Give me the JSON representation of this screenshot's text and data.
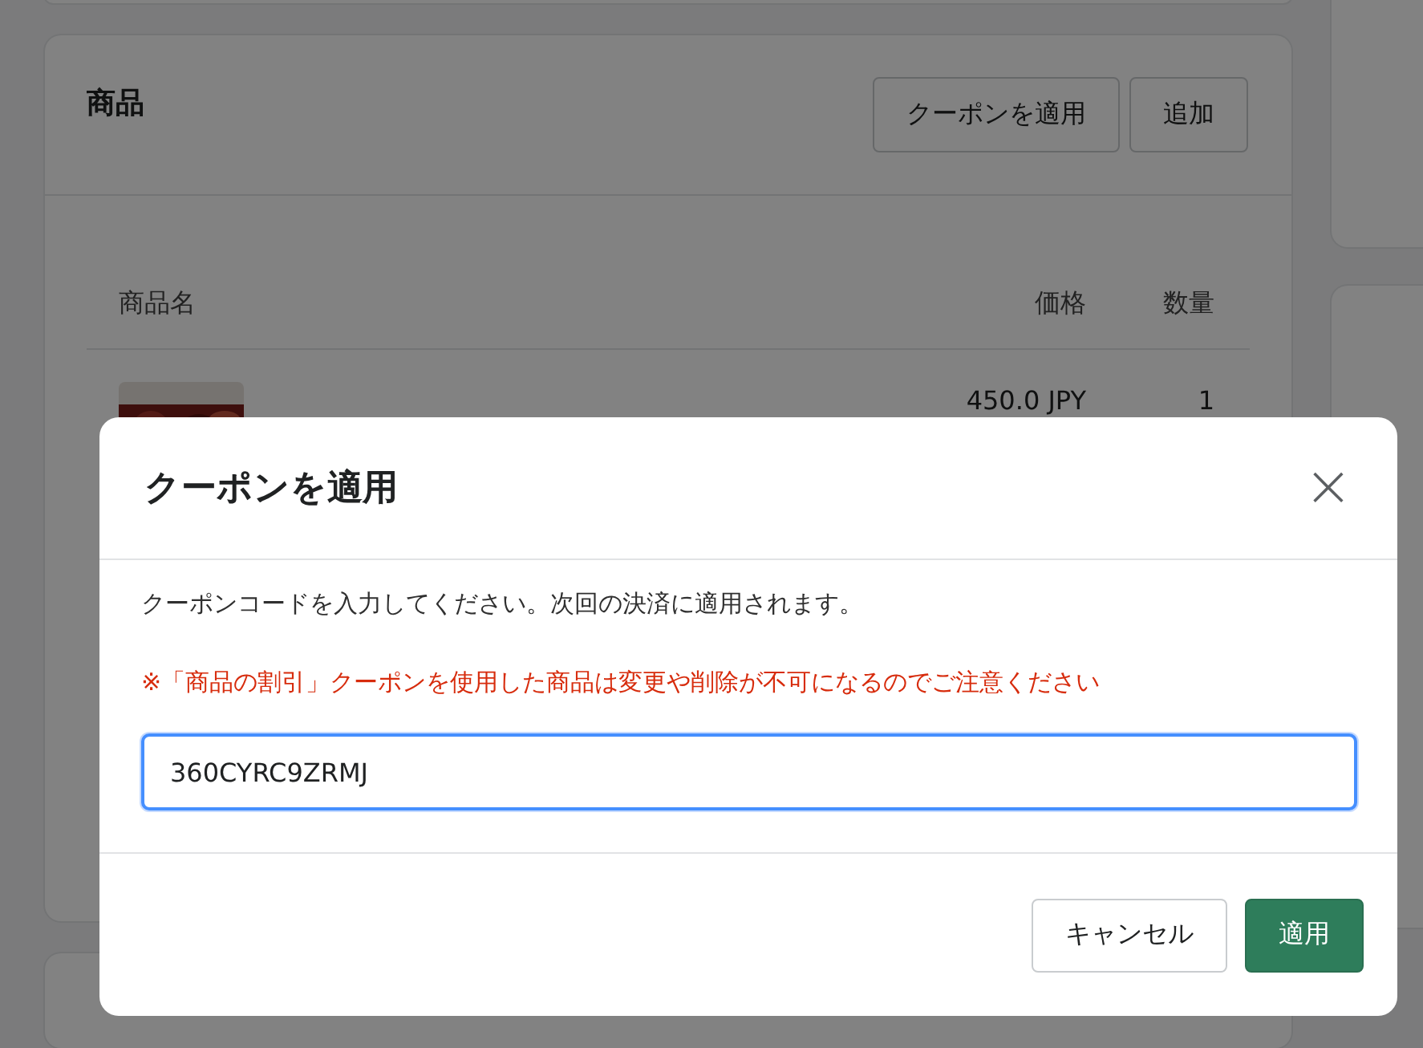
{
  "products_card": {
    "title": "商品",
    "actions": [
      "クーポンを適用",
      "追加"
    ],
    "columns": [
      "商品名",
      "価格",
      "数量"
    ],
    "rows": [
      {
        "price": "450.0 JPY",
        "quantity": "1"
      }
    ]
  },
  "dialog": {
    "title": "クーポンを適用",
    "close": "×",
    "description": "クーポンコードを入力してください。次回の決済に適用されます。",
    "warning": "※「商品の割引」クーポンを使用した商品は変更や削除が不可になるのでご注意ください",
    "coupon_field": {
      "value": "360CYRC9ZRMJ"
    },
    "buttons": [
      {
        "label": "キャンセル",
        "kind": "secondary"
      },
      {
        "label": "適用",
        "kind": "primary"
      }
    ]
  }
}
